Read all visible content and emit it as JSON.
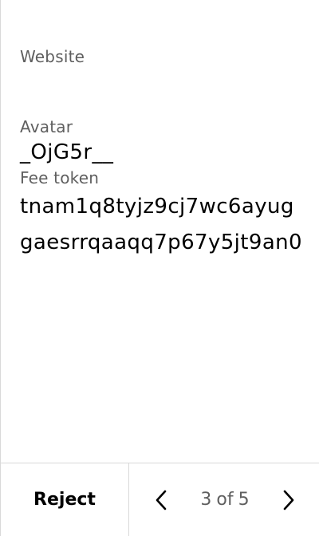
{
  "fields": {
    "website": {
      "label": "Website"
    },
    "avatar": {
      "label": "Avatar",
      "value": "_OjG5r__"
    },
    "fee_token": {
      "label": "Fee token",
      "value": "tnam1q8tyjz9cj7wc6ayuggaesrrqaaqq7p67y5jt9an0"
    }
  },
  "footer": {
    "reject_label": "Reject",
    "pager": {
      "current": "3",
      "separator": "of",
      "total": "5",
      "prev_icon": "chevron-left-icon",
      "next_icon": "chevron-right-icon"
    }
  }
}
